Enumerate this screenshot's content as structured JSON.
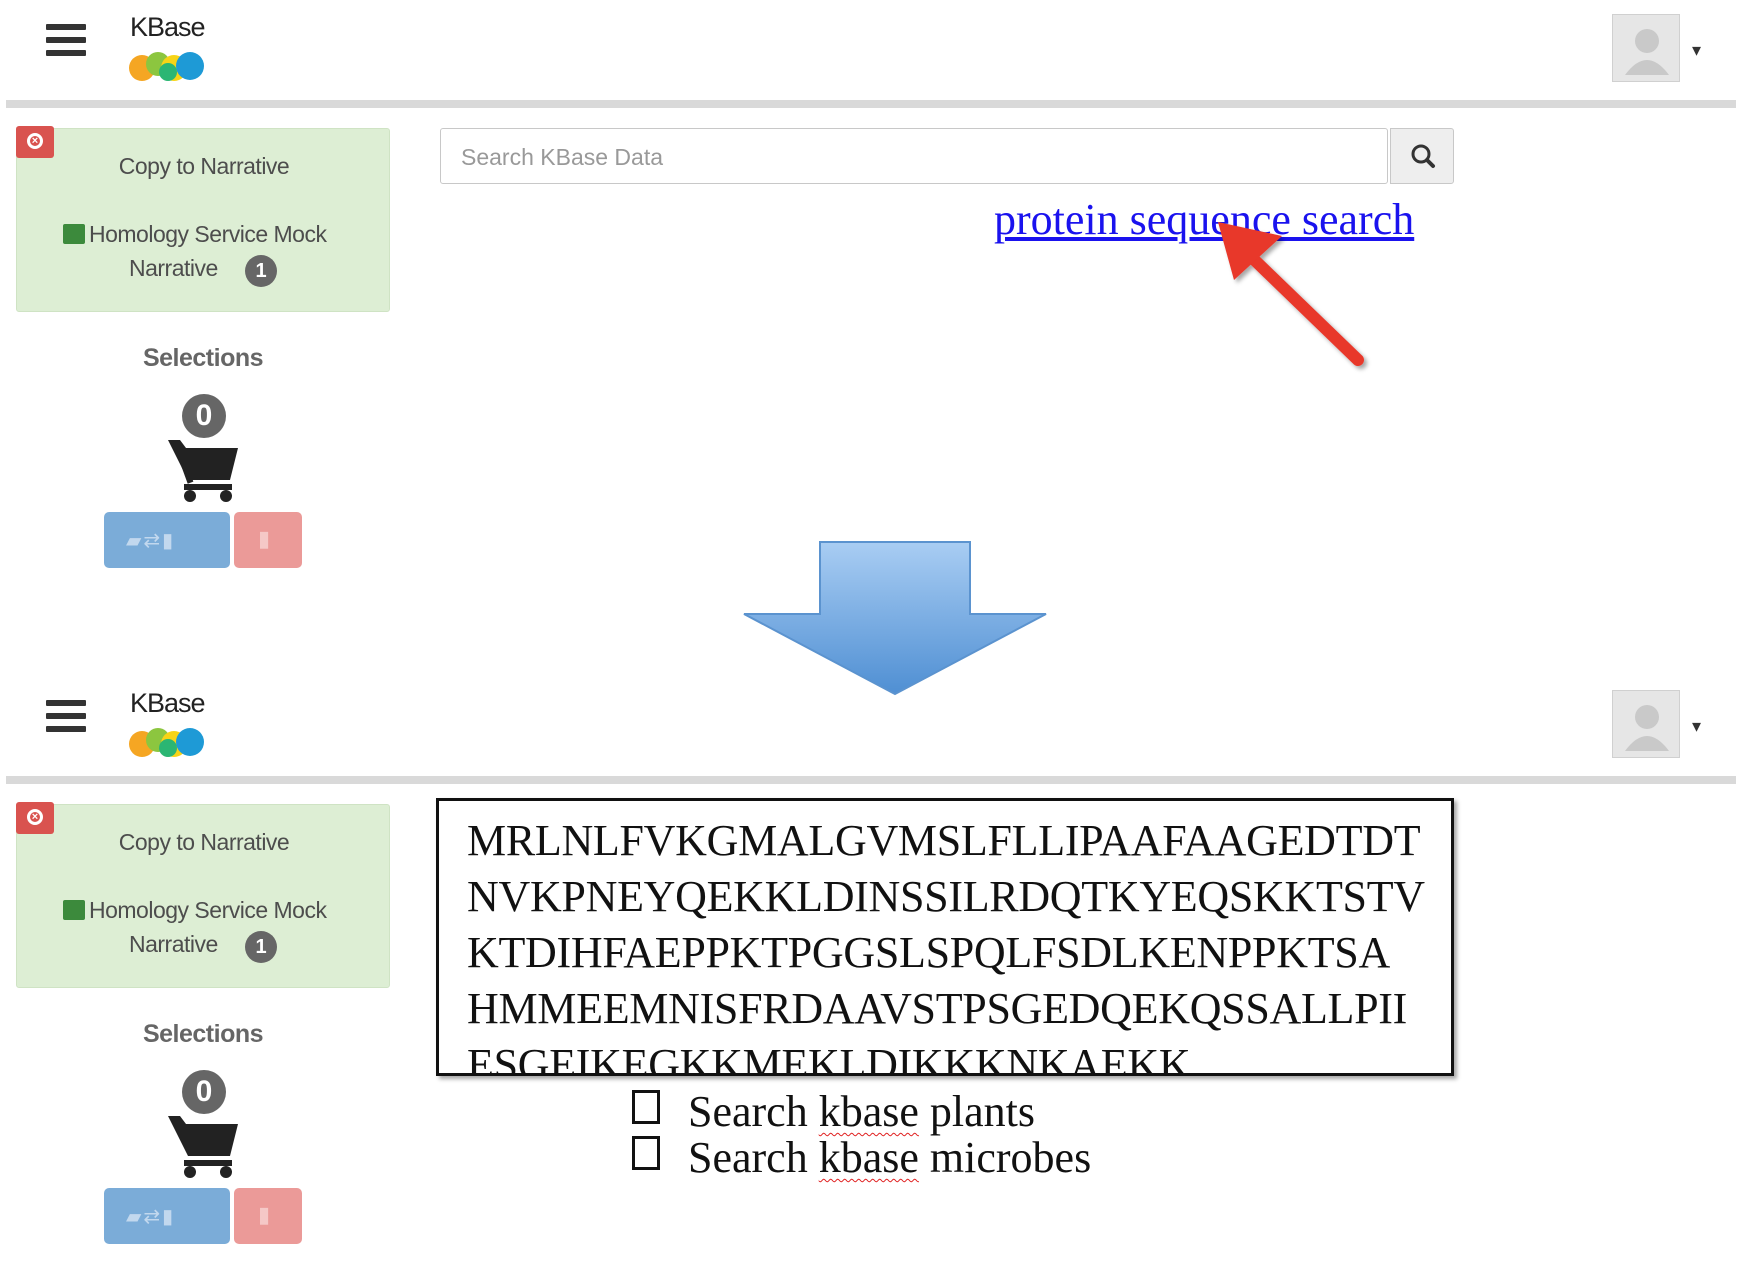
{
  "header": {
    "logo_text": "KBase",
    "menu_icon": "hamburger-menu-icon",
    "avatar_icon": "user-avatar-icon"
  },
  "sidebar": {
    "copy_label": "Copy to Narrative",
    "narrative_name_line1": "Homology Service Mock",
    "narrative_name_line2": "Narrative",
    "narrative_count": "1",
    "selections_label": "Selections",
    "selections_count": "0"
  },
  "search": {
    "placeholder": "Search KBase Data",
    "button_icon": "search-icon"
  },
  "annotation": {
    "link_text": "protein sequence search",
    "arrow_color": "#e8372c",
    "transition_arrow_color": "#6fa3dc"
  },
  "sequence_input": {
    "lines": [
      "MRLNLFVKGMALGVMSLFLLIPAAFAAGEDTDT",
      "NVKPNEYQEKKLDINSSILRDQTKYEQSKKTSTV",
      "KTDIHFAEPPKTPGGSLSPQLFSDLKENPPKTSA",
      "HMMEEMNISFRDAAVSTPSGEDQEKQSSALLPII",
      "ESGEIKEGKKMEKLDIKKKNKAEKK"
    ]
  },
  "options": [
    {
      "prefix": "Search ",
      "word": "kbase",
      "suffix": " plants"
    },
    {
      "prefix": "Search ",
      "word": "kbase",
      "suffix": " microbes"
    }
  ],
  "colors": {
    "card_green": "#ddeed4",
    "close_red": "#d9534f",
    "transfer_blue": "#7bacd8",
    "delete_pink": "#eb9a98",
    "link_blue": "#1a12ee"
  }
}
